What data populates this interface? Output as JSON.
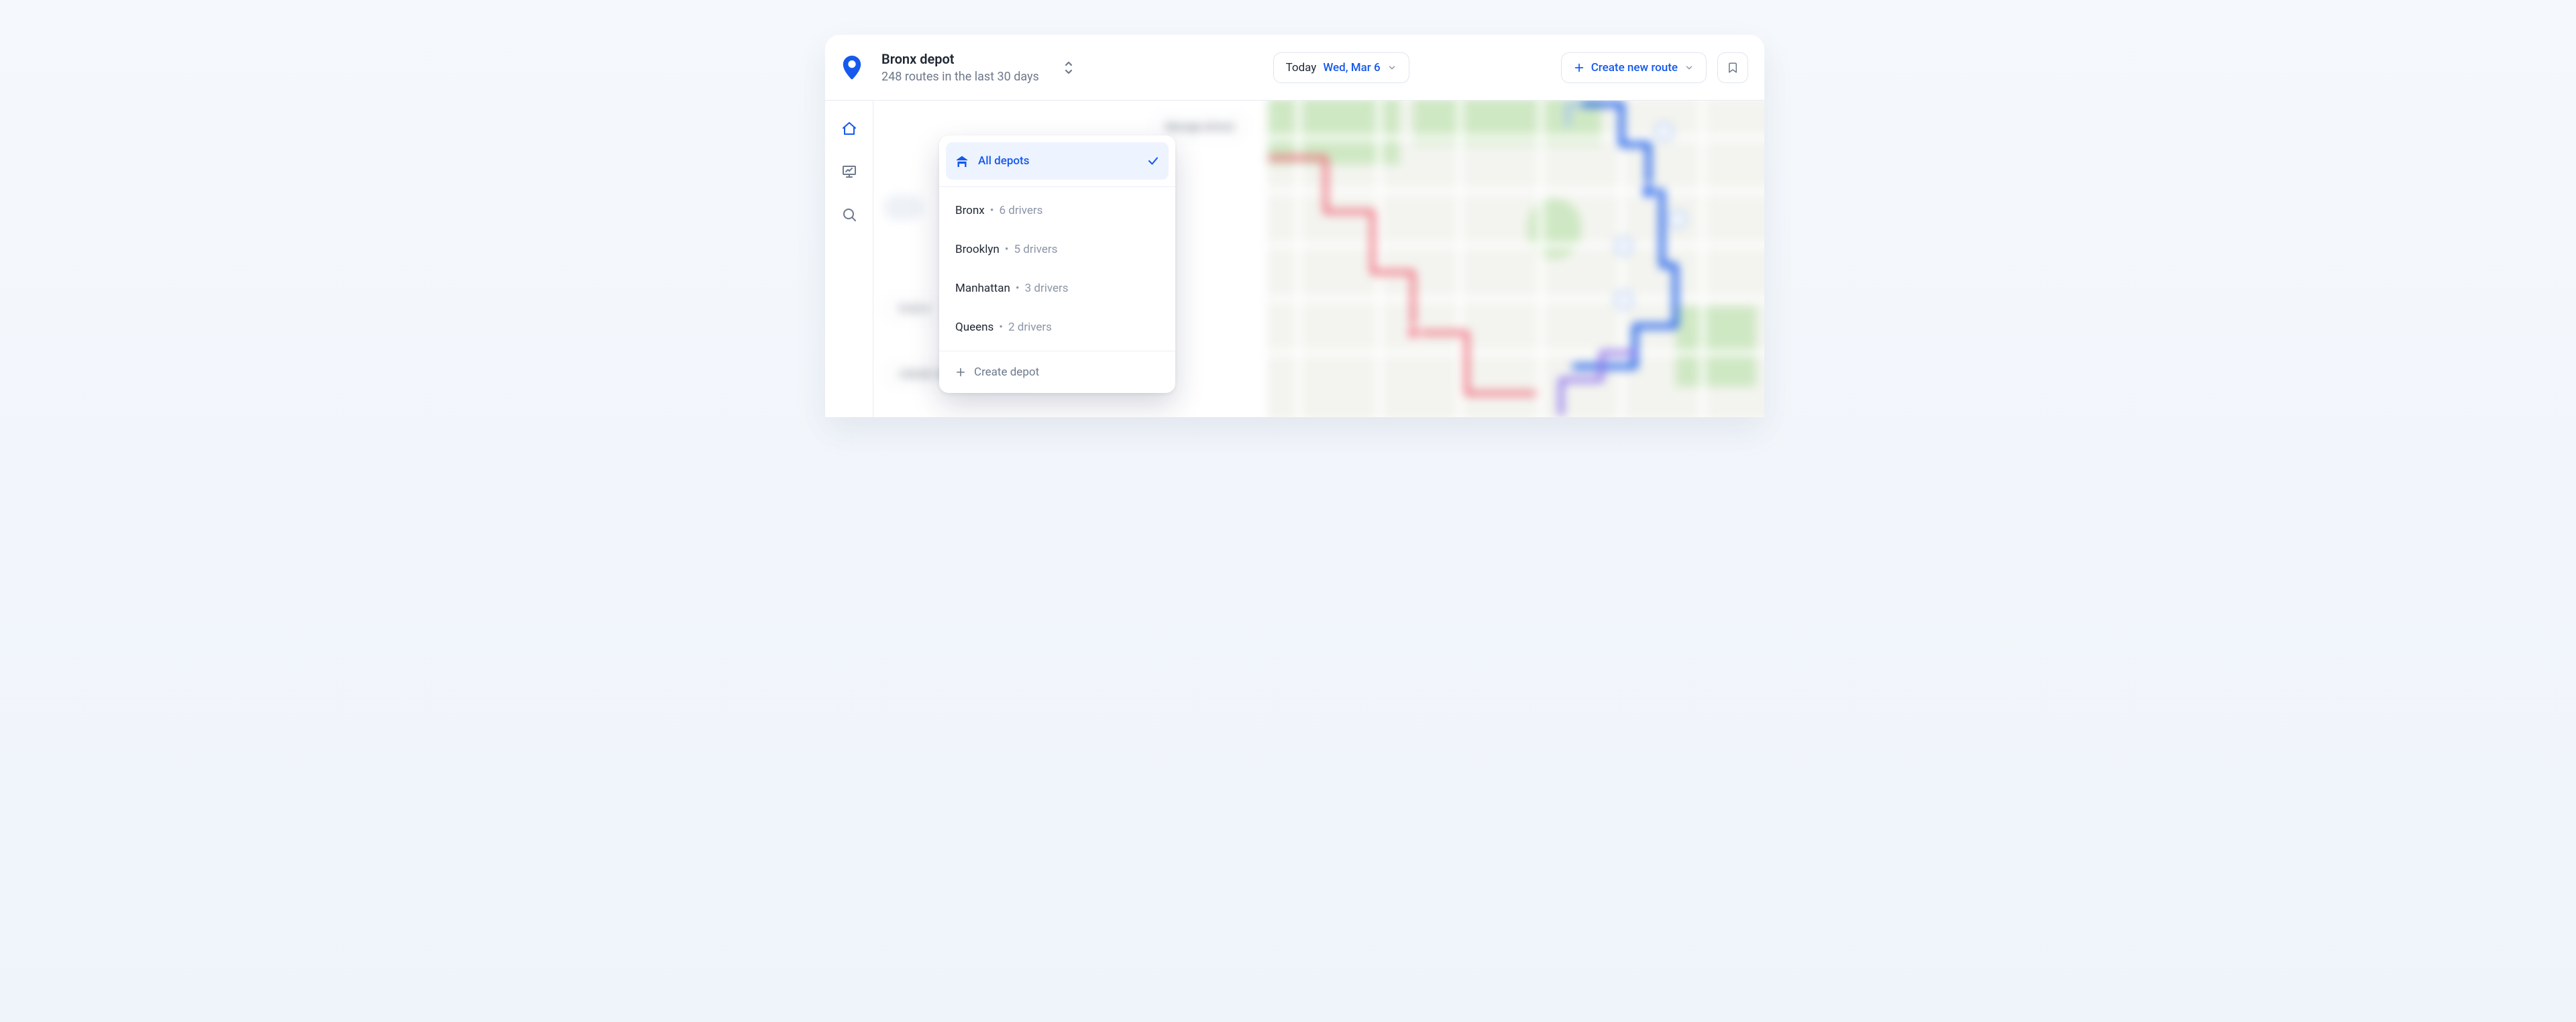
{
  "header": {
    "depot_title": "Bronx depot",
    "depot_subtitle": "248 routes in the last 30 days",
    "date_prefix": "Today",
    "date_value": "Wed, Mar 6",
    "create_route_label": "Create new route"
  },
  "depot_dropdown": {
    "all_label": "All depots",
    "items": [
      {
        "name": "Bronx",
        "meta": "6 drivers"
      },
      {
        "name": "Brooklyn",
        "meta": "5 drivers"
      },
      {
        "name": "Manhattan",
        "meta": "3 drivers"
      },
      {
        "name": "Queens",
        "meta": "2 drivers"
      }
    ],
    "create_label": "Create depot"
  },
  "background": {
    "manage_drivers": "Manage drivers",
    "time_chip_1": "10:02",
    "time_chip_2": "09:00-10:00",
    "time_chip_3": "5min"
  },
  "colors": {
    "primary": "#1559ed",
    "route_red": "#f06a7b",
    "route_purple": "#8a6df0",
    "park_green": "#cfe8c4"
  }
}
